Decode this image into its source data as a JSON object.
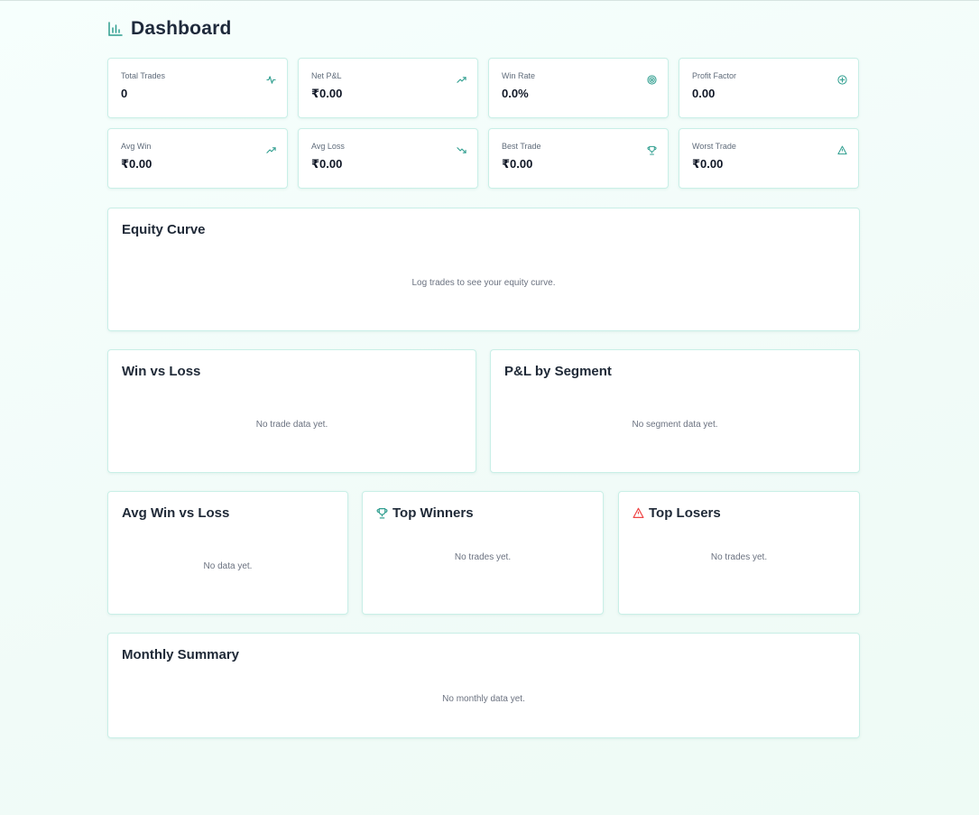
{
  "header": {
    "title": "Dashboard",
    "icon": "bar-chart-icon"
  },
  "stats": [
    {
      "label": "Total Trades",
      "value": "0",
      "icon": "activity-icon"
    },
    {
      "label": "Net P&L",
      "value": "₹0.00",
      "icon": "trending-up-icon"
    },
    {
      "label": "Win Rate",
      "value": "0.0%",
      "icon": "target-icon"
    },
    {
      "label": "Profit Factor",
      "value": "0.00",
      "icon": "gauge-icon"
    },
    {
      "label": "Avg Win",
      "value": "₹0.00",
      "icon": "trending-up-icon"
    },
    {
      "label": "Avg Loss",
      "value": "₹0.00",
      "icon": "trending-down-icon"
    },
    {
      "label": "Best Trade",
      "value": "₹0.00",
      "icon": "trophy-icon"
    },
    {
      "label": "Worst Trade",
      "value": "₹0.00",
      "icon": "alert-triangle-icon"
    }
  ],
  "equity": {
    "title": "Equity Curve",
    "empty": "Log trades to see your equity curve."
  },
  "win_loss": {
    "title": "Win vs Loss",
    "empty": "No trade data yet."
  },
  "segment": {
    "title": "P&L by Segment",
    "empty": "No segment data yet."
  },
  "avg_win_loss": {
    "title": "Avg Win vs Loss",
    "empty": "No data yet."
  },
  "top_winners": {
    "title": "Top Winners",
    "empty": "No trades yet.",
    "icon": "trophy-icon"
  },
  "top_losers": {
    "title": "Top Losers",
    "empty": "No trades yet.",
    "icon": "alert-triangle-icon"
  },
  "monthly": {
    "title": "Monthly Summary",
    "empty": "No monthly data yet."
  },
  "colors": {
    "accent": "#2f9e8f",
    "danger": "#ef4444",
    "border": "#c9efe7"
  }
}
